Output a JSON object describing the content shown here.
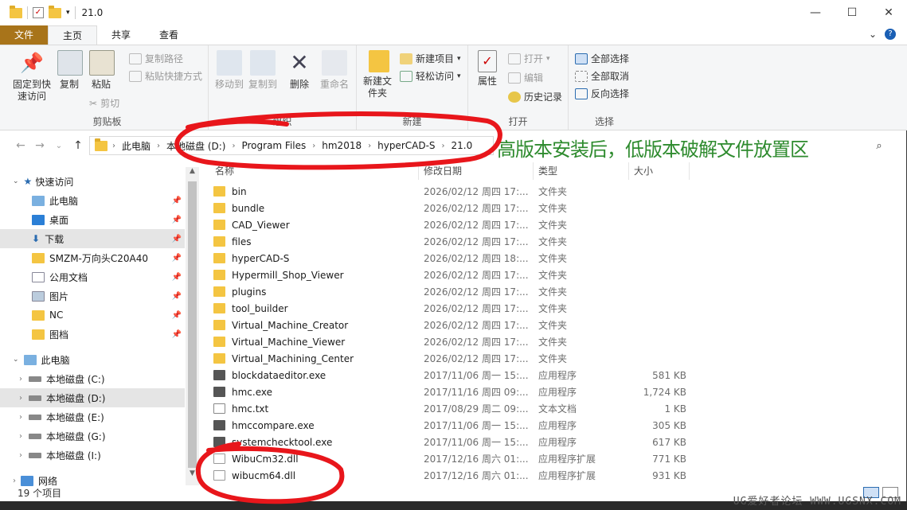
{
  "window": {
    "title": "21.0"
  },
  "tabs": [
    "文件",
    "主页",
    "共享",
    "查看"
  ],
  "ribbon": {
    "clipboard": {
      "label": "剪贴板",
      "pin": "固定到快速访问",
      "copy": "复制",
      "paste": "粘贴",
      "copy_path": "复制路径",
      "paste_shortcut": "粘贴快捷方式",
      "cut": "剪切"
    },
    "organize": {
      "label": "组织",
      "move_to": "移动到",
      "copy_to": "复制到",
      "delete": "删除",
      "rename": "重命名"
    },
    "new": {
      "label": "新建",
      "new_folder": "新建文件夹",
      "new_item": "新建项目",
      "easy_access": "轻松访问"
    },
    "open": {
      "label": "打开",
      "properties": "属性",
      "open": "打开",
      "edit": "编辑",
      "history": "历史记录"
    },
    "select": {
      "label": "选择",
      "select_all": "全部选择",
      "select_none": "全部取消",
      "invert": "反向选择"
    }
  },
  "address": {
    "crumbs": [
      "此电脑",
      "本地磁盘 (D:)",
      "Program Files",
      "hm2018",
      "hyperCAD-S",
      "21.0"
    ]
  },
  "annotation": "高版本安装后，低版本破解文件放置区",
  "nav": {
    "quick_access": "快速访问",
    "items": [
      "此电脑",
      "桌面",
      "下载",
      "SMZM-万向头C20A40",
      "公用文档",
      "图片",
      "NC",
      "图档"
    ],
    "this_pc": "此电脑",
    "drives": [
      "本地磁盘 (C:)",
      "本地磁盘 (D:)",
      "本地磁盘 (E:)",
      "本地磁盘 (G:)",
      "本地磁盘 (I:)"
    ],
    "network": "网络"
  },
  "columns": {
    "name": "名称",
    "date": "修改日期",
    "type": "类型",
    "size": "大小"
  },
  "files": [
    {
      "name": "bin",
      "date": "2026/02/12 周四 17:...",
      "type": "文件夹",
      "size": ""
    },
    {
      "name": "bundle",
      "date": "2026/02/12 周四 17:...",
      "type": "文件夹",
      "size": ""
    },
    {
      "name": "CAD_Viewer",
      "date": "2026/02/12 周四 17:...",
      "type": "文件夹",
      "size": ""
    },
    {
      "name": "files",
      "date": "2026/02/12 周四 17:...",
      "type": "文件夹",
      "size": ""
    },
    {
      "name": "hyperCAD-S",
      "date": "2026/02/12 周四 18:...",
      "type": "文件夹",
      "size": ""
    },
    {
      "name": "Hypermill_Shop_Viewer",
      "date": "2026/02/12 周四 17:...",
      "type": "文件夹",
      "size": ""
    },
    {
      "name": "plugins",
      "date": "2026/02/12 周四 17:...",
      "type": "文件夹",
      "size": ""
    },
    {
      "name": "tool_builder",
      "date": "2026/02/12 周四 17:...",
      "type": "文件夹",
      "size": ""
    },
    {
      "name": "Virtual_Machine_Creator",
      "date": "2026/02/12 周四 17:...",
      "type": "文件夹",
      "size": ""
    },
    {
      "name": "Virtual_Machine_Viewer",
      "date": "2026/02/12 周四 17:...",
      "type": "文件夹",
      "size": ""
    },
    {
      "name": "Virtual_Machining_Center",
      "date": "2026/02/12 周四 17:...",
      "type": "文件夹",
      "size": ""
    },
    {
      "name": "blockdataeditor.exe",
      "date": "2017/11/06 周一 15:...",
      "type": "应用程序",
      "size": "581 KB"
    },
    {
      "name": "hmc.exe",
      "date": "2017/11/16 周四 09:...",
      "type": "应用程序",
      "size": "1,724 KB"
    },
    {
      "name": "hmc.txt",
      "date": "2017/08/29 周二 09:...",
      "type": "文本文档",
      "size": "1 KB"
    },
    {
      "name": "hmccompare.exe",
      "date": "2017/11/06 周一 15:...",
      "type": "应用程序",
      "size": "305 KB"
    },
    {
      "name": "systemchecktool.exe",
      "date": "2017/11/06 周一 15:...",
      "type": "应用程序",
      "size": "617 KB"
    },
    {
      "name": "WibuCm32.dll",
      "date": "2017/12/16 周六 01:...",
      "type": "应用程序扩展",
      "size": "771 KB"
    },
    {
      "name": "wibucm64.dll",
      "date": "2017/12/16 周六 01:...",
      "type": "应用程序扩展",
      "size": "931 KB"
    }
  ],
  "status": "19 个项目",
  "watermark": "UG爱好者论坛 WWW.UGSNX.COM",
  "colors": {
    "file_tab": "#a8741a",
    "folder": "#f4c542",
    "annotation_green": "#2e8b2e",
    "annotation_red": "#e8161b"
  }
}
